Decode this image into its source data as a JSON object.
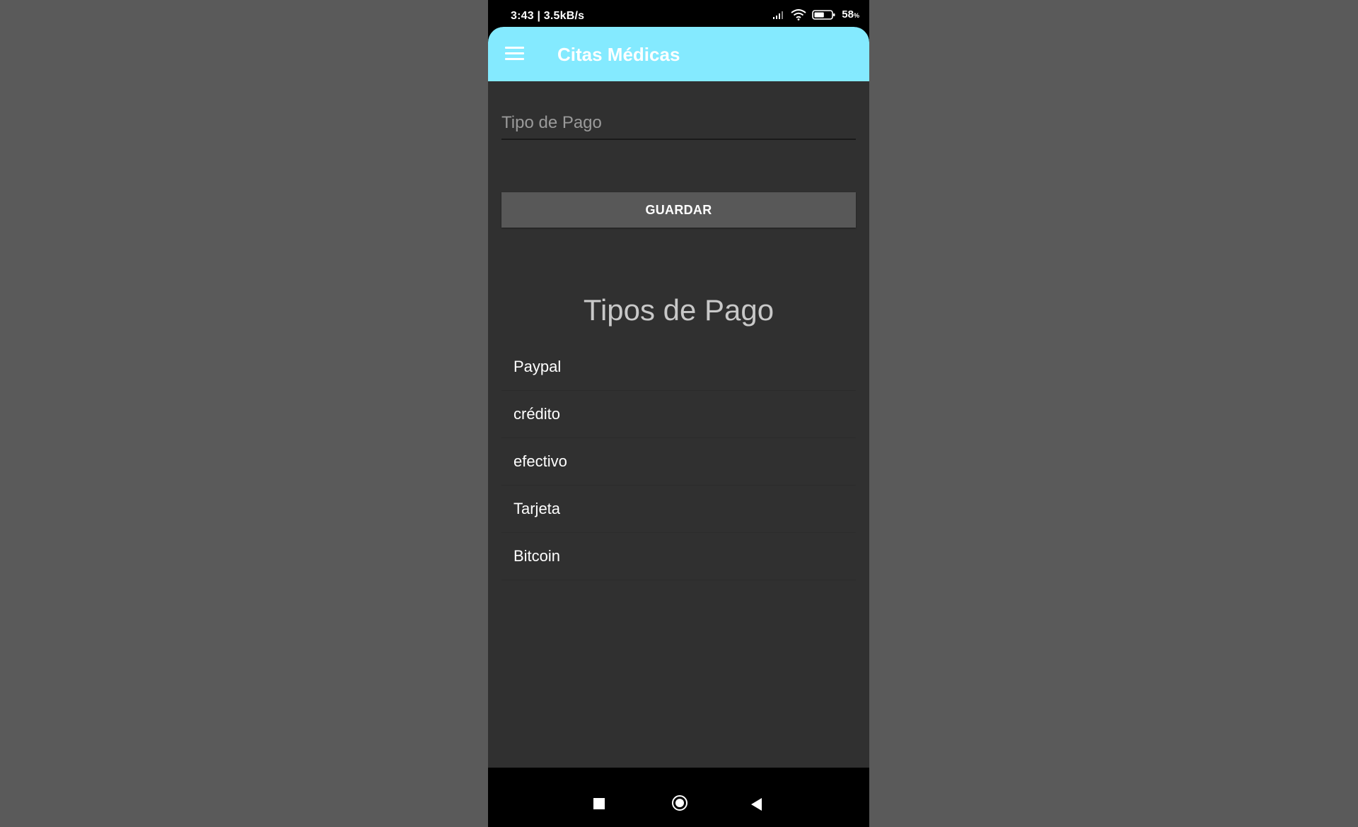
{
  "status_bar": {
    "time_speed": "3:43 | 3.5kB/s",
    "battery_percent": "58",
    "battery_unit": "%",
    "battery_level": 0.58,
    "icons": [
      "signal-icon",
      "wifi-icon",
      "battery-icon"
    ]
  },
  "app_bar": {
    "title": "Citas Médicas",
    "color": "#84eaff",
    "menu_icon": "hamburger-menu-icon"
  },
  "form": {
    "input_placeholder": "Tipo de Pago",
    "input_value": "",
    "save_label": "GUARDAR"
  },
  "list": {
    "title": "Tipos de Pago",
    "items": [
      {
        "label": "Paypal"
      },
      {
        "label": "crédito"
      },
      {
        "label": "efectivo"
      },
      {
        "label": "Tarjeta"
      },
      {
        "label": "Bitcoin"
      }
    ]
  },
  "nav_bar": {
    "icons": [
      "recent-apps-icon",
      "home-icon",
      "back-icon"
    ]
  }
}
